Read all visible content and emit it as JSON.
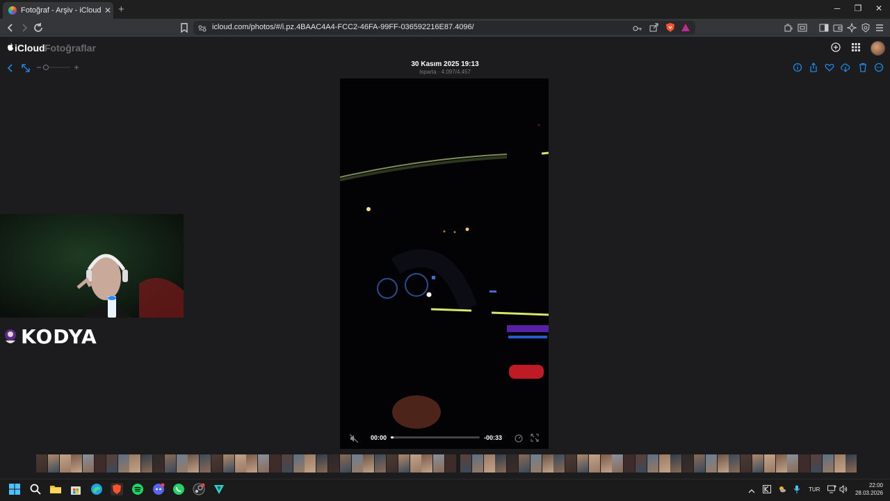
{
  "browser": {
    "tab_title": "Fotoğraf - Arşiv - iCloud Fotoğraf",
    "url": "icloud.com/photos/#/i.pz.4BAAC4A4-FCC2-46FA-99FF-036592216E87.4096/"
  },
  "app": {
    "brand_primary": "iCloud",
    "brand_secondary": "Fotoğraflar"
  },
  "viewer": {
    "date": "30 Kasım 2025 19:13",
    "location": "Isparta · 4.097/4.457"
  },
  "video": {
    "time_elapsed": "00:00",
    "time_remaining": "-00:33",
    "progress": 0.0
  },
  "overlay": {
    "streamer_name": "KODYA"
  },
  "taskbar": {
    "lang": "TUR",
    "time": "22:00",
    "date": "28.03.2026"
  },
  "colors": {
    "accent": "#1e88e5",
    "background": "#1c1c1e"
  },
  "icons": [
    "back-icon",
    "forward-icon",
    "reload-icon",
    "bookmark-icon",
    "site-settings-icon",
    "key-icon",
    "share-icon",
    "brave-shield-icon",
    "rewards-icon",
    "extensions-icon",
    "tab-icon",
    "sidebar-icon",
    "wallet-icon",
    "leo-icon",
    "vpn-icon",
    "menu-icon",
    "add-icon",
    "apps-grid-icon",
    "info-icon",
    "heart-icon",
    "download-icon",
    "trash-icon",
    "more-icon",
    "mute-icon",
    "speed-icon",
    "fullscreen-icon"
  ]
}
